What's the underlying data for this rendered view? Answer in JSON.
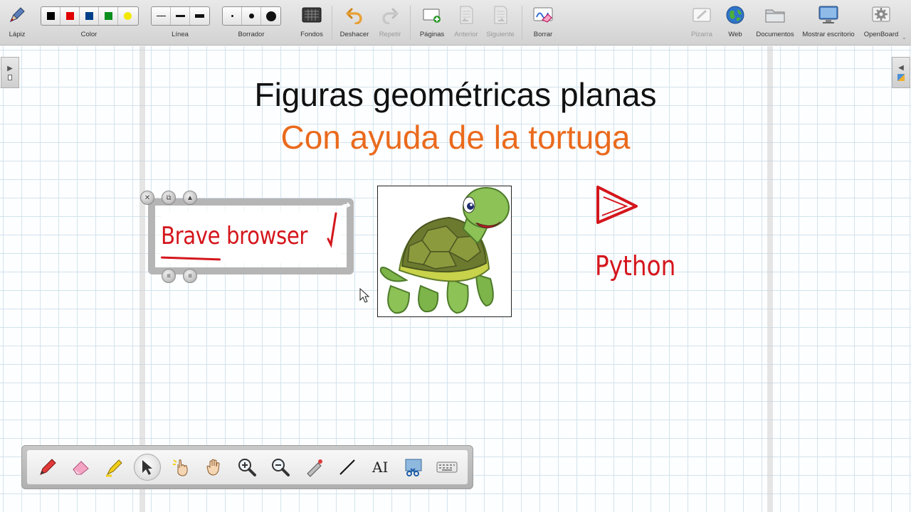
{
  "toolbar": {
    "items": [
      {
        "label": "Lápiz",
        "icon": "pen-icon"
      },
      {
        "label": "Color",
        "icon": "color-palette"
      },
      {
        "label": "Línea",
        "icon": "line-width"
      },
      {
        "label": "Borrador",
        "icon": "eraser-size"
      },
      {
        "label": "Fondos",
        "icon": "background-icon"
      },
      {
        "label": "Deshacer",
        "icon": "undo-icon"
      },
      {
        "label": "Repetir",
        "icon": "redo-icon"
      },
      {
        "label": "Páginas",
        "icon": "add-page-icon"
      },
      {
        "label": "Anterior",
        "icon": "previous-page-icon"
      },
      {
        "label": "Siguiente",
        "icon": "next-page-icon"
      },
      {
        "label": "Borrar",
        "icon": "clear-page-icon"
      },
      {
        "label": "Pizarra",
        "icon": "board-icon"
      },
      {
        "label": "Web",
        "icon": "globe-icon"
      },
      {
        "label": "Documentos",
        "icon": "folder-icon"
      },
      {
        "label": "Mostrar escritorio",
        "icon": "desktop-icon"
      },
      {
        "label": "OpenBoard",
        "icon": "settings-icon"
      }
    ],
    "colors": [
      "#000000",
      "#e00000",
      "#003f8a",
      "#0a8f1e",
      "#f4e800"
    ]
  },
  "board": {
    "title": "Figuras geométricas planas",
    "subtitle": "Con ayuda de la tortuga",
    "handwriting_note": "Brave browser",
    "handwriting_python": "Python",
    "accent_color": "#ea6a1d",
    "ink_color": "#d4161c"
  },
  "bottom_tools": [
    "pen-tool-icon",
    "eraser-tool-icon",
    "marker-tool-icon",
    "selector-tool-icon",
    "interact-tool-icon",
    "hand-pan-tool-icon",
    "zoom-in-icon",
    "zoom-out-icon",
    "laser-pointer-icon",
    "line-tool-icon",
    "text-tool-icon",
    "capture-tool-icon",
    "keyboard-icon"
  ],
  "bottom_text_tool_glyph": "AI"
}
